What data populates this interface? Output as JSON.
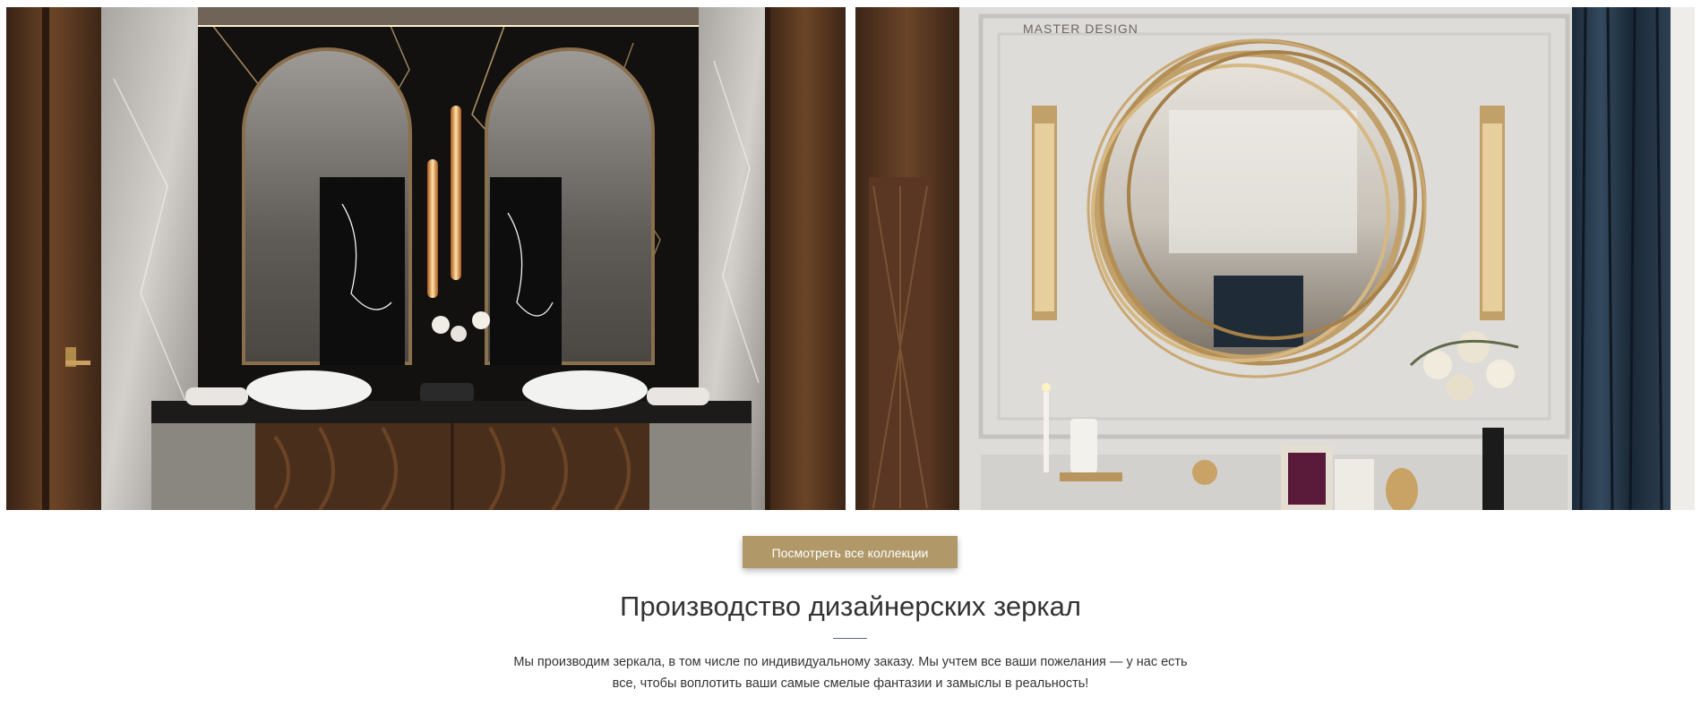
{
  "gallery": {
    "left_image": {
      "alt": "bathroom-vanity-with-arched-mirrors"
    },
    "right_image": {
      "alt": "round-gold-ring-mirror-interior",
      "watermark": "MASTER DESIGN"
    }
  },
  "cta": {
    "label": "Посмотреть все коллекции"
  },
  "section": {
    "title": "Производство дизайнерских зеркал",
    "text_line1": "Мы производим зеркала, в том числе по индивидуальному заказу. Мы учтем все ваши пожелания — у нас есть",
    "text_line2": "все, чтобы воплотить ваши самые смелые фантазии и замыслы в реальность!"
  },
  "colors": {
    "accent": "#b09868",
    "text": "#333333",
    "divider": "#5a6a7a"
  }
}
